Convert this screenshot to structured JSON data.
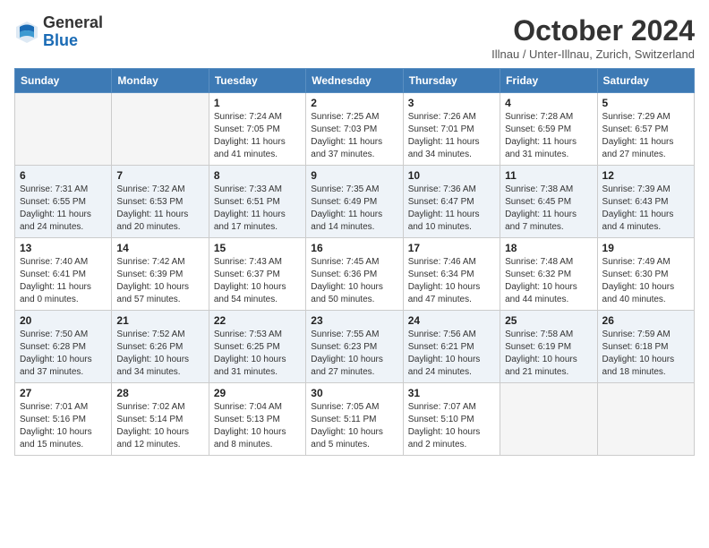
{
  "header": {
    "logo_general": "General",
    "logo_blue": "Blue",
    "month_title": "October 2024",
    "location": "Illnau / Unter-Illnau, Zurich, Switzerland"
  },
  "weekdays": [
    "Sunday",
    "Monday",
    "Tuesday",
    "Wednesday",
    "Thursday",
    "Friday",
    "Saturday"
  ],
  "weeks": [
    [
      {
        "day": "",
        "info": ""
      },
      {
        "day": "",
        "info": ""
      },
      {
        "day": "1",
        "info": "Sunrise: 7:24 AM\nSunset: 7:05 PM\nDaylight: 11 hours and 41 minutes."
      },
      {
        "day": "2",
        "info": "Sunrise: 7:25 AM\nSunset: 7:03 PM\nDaylight: 11 hours and 37 minutes."
      },
      {
        "day": "3",
        "info": "Sunrise: 7:26 AM\nSunset: 7:01 PM\nDaylight: 11 hours and 34 minutes."
      },
      {
        "day": "4",
        "info": "Sunrise: 7:28 AM\nSunset: 6:59 PM\nDaylight: 11 hours and 31 minutes."
      },
      {
        "day": "5",
        "info": "Sunrise: 7:29 AM\nSunset: 6:57 PM\nDaylight: 11 hours and 27 minutes."
      }
    ],
    [
      {
        "day": "6",
        "info": "Sunrise: 7:31 AM\nSunset: 6:55 PM\nDaylight: 11 hours and 24 minutes."
      },
      {
        "day": "7",
        "info": "Sunrise: 7:32 AM\nSunset: 6:53 PM\nDaylight: 11 hours and 20 minutes."
      },
      {
        "day": "8",
        "info": "Sunrise: 7:33 AM\nSunset: 6:51 PM\nDaylight: 11 hours and 17 minutes."
      },
      {
        "day": "9",
        "info": "Sunrise: 7:35 AM\nSunset: 6:49 PM\nDaylight: 11 hours and 14 minutes."
      },
      {
        "day": "10",
        "info": "Sunrise: 7:36 AM\nSunset: 6:47 PM\nDaylight: 11 hours and 10 minutes."
      },
      {
        "day": "11",
        "info": "Sunrise: 7:38 AM\nSunset: 6:45 PM\nDaylight: 11 hours and 7 minutes."
      },
      {
        "day": "12",
        "info": "Sunrise: 7:39 AM\nSunset: 6:43 PM\nDaylight: 11 hours and 4 minutes."
      }
    ],
    [
      {
        "day": "13",
        "info": "Sunrise: 7:40 AM\nSunset: 6:41 PM\nDaylight: 11 hours and 0 minutes."
      },
      {
        "day": "14",
        "info": "Sunrise: 7:42 AM\nSunset: 6:39 PM\nDaylight: 10 hours and 57 minutes."
      },
      {
        "day": "15",
        "info": "Sunrise: 7:43 AM\nSunset: 6:37 PM\nDaylight: 10 hours and 54 minutes."
      },
      {
        "day": "16",
        "info": "Sunrise: 7:45 AM\nSunset: 6:36 PM\nDaylight: 10 hours and 50 minutes."
      },
      {
        "day": "17",
        "info": "Sunrise: 7:46 AM\nSunset: 6:34 PM\nDaylight: 10 hours and 47 minutes."
      },
      {
        "day": "18",
        "info": "Sunrise: 7:48 AM\nSunset: 6:32 PM\nDaylight: 10 hours and 44 minutes."
      },
      {
        "day": "19",
        "info": "Sunrise: 7:49 AM\nSunset: 6:30 PM\nDaylight: 10 hours and 40 minutes."
      }
    ],
    [
      {
        "day": "20",
        "info": "Sunrise: 7:50 AM\nSunset: 6:28 PM\nDaylight: 10 hours and 37 minutes."
      },
      {
        "day": "21",
        "info": "Sunrise: 7:52 AM\nSunset: 6:26 PM\nDaylight: 10 hours and 34 minutes."
      },
      {
        "day": "22",
        "info": "Sunrise: 7:53 AM\nSunset: 6:25 PM\nDaylight: 10 hours and 31 minutes."
      },
      {
        "day": "23",
        "info": "Sunrise: 7:55 AM\nSunset: 6:23 PM\nDaylight: 10 hours and 27 minutes."
      },
      {
        "day": "24",
        "info": "Sunrise: 7:56 AM\nSunset: 6:21 PM\nDaylight: 10 hours and 24 minutes."
      },
      {
        "day": "25",
        "info": "Sunrise: 7:58 AM\nSunset: 6:19 PM\nDaylight: 10 hours and 21 minutes."
      },
      {
        "day": "26",
        "info": "Sunrise: 7:59 AM\nSunset: 6:18 PM\nDaylight: 10 hours and 18 minutes."
      }
    ],
    [
      {
        "day": "27",
        "info": "Sunrise: 7:01 AM\nSunset: 5:16 PM\nDaylight: 10 hours and 15 minutes."
      },
      {
        "day": "28",
        "info": "Sunrise: 7:02 AM\nSunset: 5:14 PM\nDaylight: 10 hours and 12 minutes."
      },
      {
        "day": "29",
        "info": "Sunrise: 7:04 AM\nSunset: 5:13 PM\nDaylight: 10 hours and 8 minutes."
      },
      {
        "day": "30",
        "info": "Sunrise: 7:05 AM\nSunset: 5:11 PM\nDaylight: 10 hours and 5 minutes."
      },
      {
        "day": "31",
        "info": "Sunrise: 7:07 AM\nSunset: 5:10 PM\nDaylight: 10 hours and 2 minutes."
      },
      {
        "day": "",
        "info": ""
      },
      {
        "day": "",
        "info": ""
      }
    ]
  ]
}
